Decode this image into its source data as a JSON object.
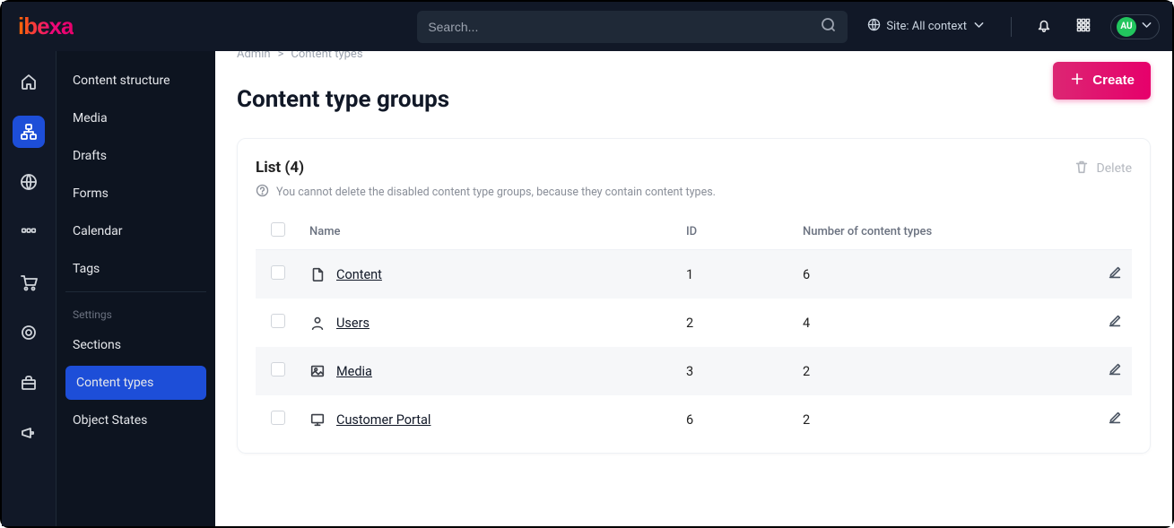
{
  "brand": "ibexa",
  "search": {
    "placeholder": "Search..."
  },
  "site_context": {
    "label": "Site: All context"
  },
  "avatar_initials": "AU",
  "rail": [
    {
      "name": "home"
    },
    {
      "name": "sitemap",
      "active": true
    },
    {
      "name": "globe"
    },
    {
      "name": "catalog"
    },
    {
      "name": "cart"
    },
    {
      "name": "target"
    },
    {
      "name": "briefcase"
    },
    {
      "name": "megaphone"
    }
  ],
  "sidebar": {
    "primary": [
      {
        "label": "Content structure"
      },
      {
        "label": "Media"
      },
      {
        "label": "Drafts"
      },
      {
        "label": "Forms"
      },
      {
        "label": "Calendar"
      },
      {
        "label": "Tags"
      }
    ],
    "settings_label": "Settings",
    "settings": [
      {
        "label": "Sections"
      },
      {
        "label": "Content types",
        "active": true
      },
      {
        "label": "Object States"
      }
    ]
  },
  "breadcrumb": {
    "parent": "Admin",
    "current": "Content types"
  },
  "page_title": "Content type groups",
  "create_label": "Create",
  "list": {
    "title": "List (4)",
    "hint": "You cannot delete the disabled content type groups, because they contain content types.",
    "delete_label": "Delete",
    "columns": {
      "name": "Name",
      "id": "ID",
      "count": "Number of content types"
    },
    "rows": [
      {
        "icon": "file",
        "name": "Content",
        "id": "1",
        "count": "6"
      },
      {
        "icon": "user",
        "name": "Users",
        "id": "2",
        "count": "4"
      },
      {
        "icon": "image",
        "name": "Media",
        "id": "3",
        "count": "2"
      },
      {
        "icon": "monitor",
        "name": "Customer Portal",
        "id": "6",
        "count": "2"
      }
    ]
  }
}
